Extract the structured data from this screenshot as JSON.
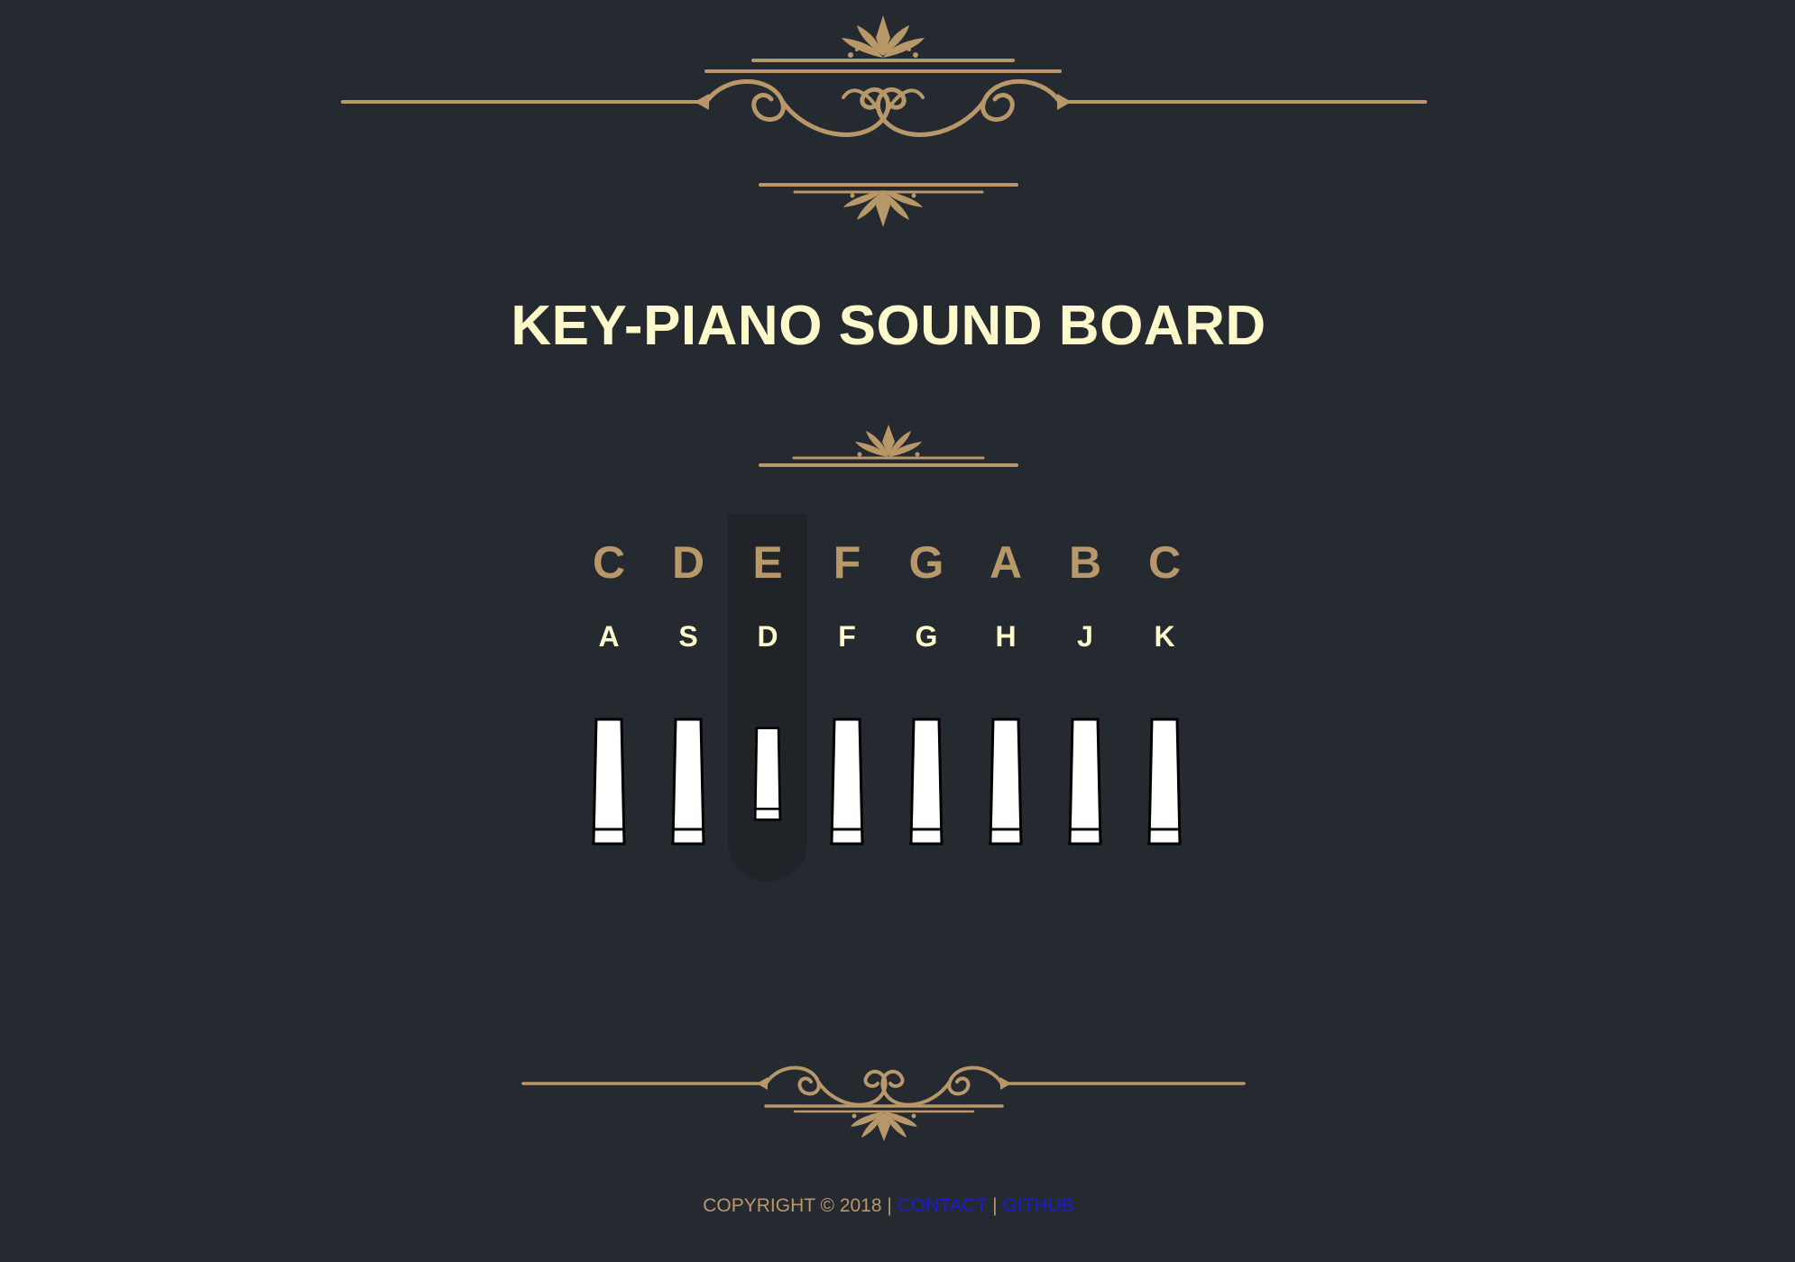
{
  "header": {
    "title": "KEY-PIANO SOUND BOARD"
  },
  "theme": {
    "background": "#252a31",
    "gold": "#b89769",
    "cream": "#fffacb",
    "link": "#1b1bd6",
    "active_highlight": "#202428"
  },
  "keys": [
    {
      "note": "C",
      "keycap": "A",
      "active": false
    },
    {
      "note": "D",
      "keycap": "S",
      "active": false
    },
    {
      "note": "E",
      "keycap": "D",
      "active": true
    },
    {
      "note": "F",
      "keycap": "F",
      "active": false
    },
    {
      "note": "G",
      "keycap": "G",
      "active": false
    },
    {
      "note": "A",
      "keycap": "H",
      "active": false
    },
    {
      "note": "B",
      "keycap": "J",
      "active": false
    },
    {
      "note": "C",
      "keycap": "K",
      "active": false
    }
  ],
  "footer": {
    "copyright": "COPYRIGHT © 2018",
    "separator": "|",
    "contact_label": "CONTACT",
    "github_label": "GITHUB"
  },
  "icons": {
    "top_ornament": "ornamental-flourish-divider-icon",
    "middle_ornament": "lotus-divider-icon",
    "bottom_ornament": "ornamental-flourish-divider-icon",
    "piano_key": "piano-key-icon"
  }
}
